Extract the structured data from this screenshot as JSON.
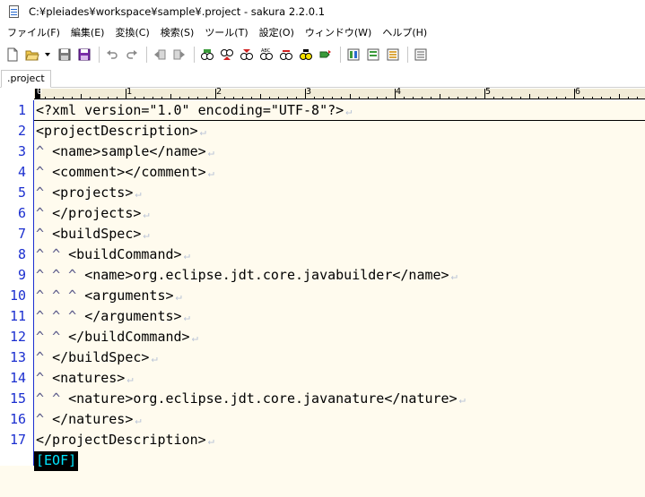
{
  "window": {
    "title": "C:¥pleiades¥workspace¥sample¥.project - sakura 2.2.0.1",
    "icon": "sakura-app-icon"
  },
  "menu": [
    {
      "label": "ファイル(F)"
    },
    {
      "label": "編集(E)"
    },
    {
      "label": "変換(C)"
    },
    {
      "label": "検索(S)"
    },
    {
      "label": "ツール(T)"
    },
    {
      "label": "設定(O)"
    },
    {
      "label": "ウィンドウ(W)"
    },
    {
      "label": "ヘルプ(H)"
    }
  ],
  "toolbar": {
    "buttons": [
      {
        "icon": "new-file-icon"
      },
      {
        "icon": "open-folder-icon"
      },
      {
        "icon": "dropdown-arrow-icon"
      },
      {
        "icon": "save-icon"
      },
      {
        "icon": "save-all-icon"
      },
      {
        "icon": "undo-icon"
      },
      {
        "icon": "redo-icon"
      },
      {
        "icon": "jump-back-icon"
      },
      {
        "icon": "jump-forward-icon"
      },
      {
        "icon": "search-icon"
      },
      {
        "icon": "search-prev-icon"
      },
      {
        "icon": "search-next-icon"
      },
      {
        "icon": "replace-icon"
      },
      {
        "icon": "grep-icon"
      },
      {
        "icon": "bookmark-search-icon"
      },
      {
        "icon": "tag-jump-icon"
      },
      {
        "icon": "compare-icon"
      },
      {
        "icon": "outline-icon"
      },
      {
        "icon": "settings-icon"
      },
      {
        "icon": "font-icon"
      }
    ]
  },
  "tabs": [
    {
      "label": ".project",
      "active": true
    }
  ],
  "ruler": {
    "labels": [
      "0",
      "1",
      "2",
      "3",
      "4",
      "5",
      "6"
    ]
  },
  "editor": {
    "line_numbers": [
      "1",
      "2",
      "3",
      "4",
      "5",
      "6",
      "7",
      "8",
      "9",
      "10",
      "11",
      "12",
      "13",
      "14",
      "15",
      "16",
      "17"
    ],
    "lines": [
      {
        "indent": 0,
        "text": "<?xml version=\"1.0\" encoding=\"UTF-8\"?>"
      },
      {
        "indent": 0,
        "text": "<projectDescription>"
      },
      {
        "indent": 1,
        "text": "<name>sample</name>"
      },
      {
        "indent": 1,
        "text": "<comment></comment>"
      },
      {
        "indent": 1,
        "text": "<projects>"
      },
      {
        "indent": 1,
        "text": "</projects>"
      },
      {
        "indent": 1,
        "text": "<buildSpec>"
      },
      {
        "indent": 2,
        "text": "<buildCommand>"
      },
      {
        "indent": 3,
        "text": "<name>org.eclipse.jdt.core.javabuilder</name>"
      },
      {
        "indent": 3,
        "text": "<arguments>"
      },
      {
        "indent": 3,
        "text": "</arguments>"
      },
      {
        "indent": 2,
        "text": "</buildCommand>"
      },
      {
        "indent": 1,
        "text": "</buildSpec>"
      },
      {
        "indent": 1,
        "text": "<natures>"
      },
      {
        "indent": 2,
        "text": "<nature>org.eclipse.jdt.core.javanature</nature>"
      },
      {
        "indent": 1,
        "text": "</natures>"
      },
      {
        "indent": 0,
        "text": "</projectDescription>"
      }
    ],
    "tab_marker": "^",
    "newline_marker": "↵",
    "eof_label": "[EOF]",
    "colors": {
      "line_number": "#1b2fd0",
      "background": "#fffbee",
      "eof_text": "#00e6ff",
      "eof_bg": "#000000"
    }
  }
}
